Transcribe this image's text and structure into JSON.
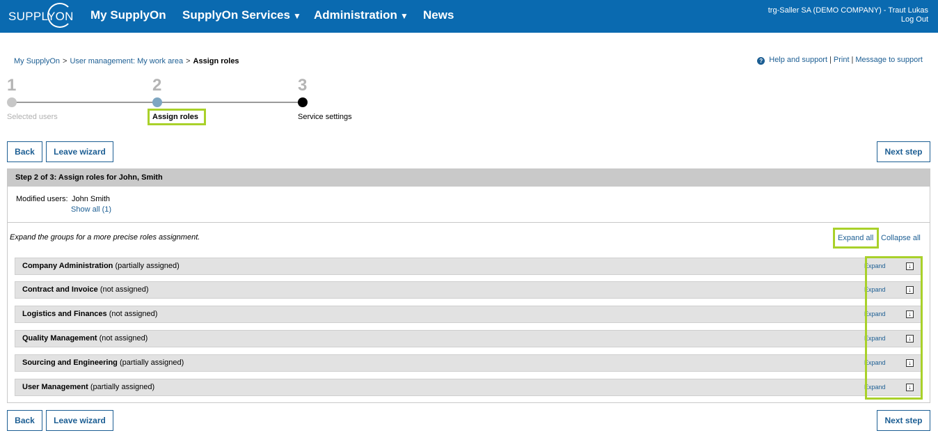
{
  "header": {
    "logo_text": "SUPPLYON",
    "nav": [
      {
        "label": "My SupplyOn"
      },
      {
        "label": "SupplyOn Services",
        "caret": "▼"
      },
      {
        "label": "Administration",
        "caret": "▼"
      },
      {
        "label": "News"
      }
    ],
    "user": "trg-Saller SA (DEMO COMPANY) - Traut Lukas",
    "logout": "Log Out"
  },
  "breadcrumb": {
    "items": [
      "My SupplyOn",
      "User management: My work area"
    ],
    "separator": ">",
    "current": "Assign roles"
  },
  "help": {
    "icon": "question-circle-icon",
    "links": [
      "Help and support",
      "Print",
      "Message to support"
    ]
  },
  "wizard": {
    "steps": [
      {
        "num": "1",
        "label": "Selected users",
        "state": "completed",
        "color": "#c7c7c7"
      },
      {
        "num": "2",
        "label": "Assign roles",
        "state": "current",
        "color": "#7ea6c1"
      },
      {
        "num": "3",
        "label": "Service settings",
        "state": "upcoming",
        "color": "#000000"
      }
    ]
  },
  "buttons": {
    "back": "Back",
    "leave": "Leave wizard",
    "next": "Next step"
  },
  "panel": {
    "title": "Step 2 of 3: Assign roles for John, Smith",
    "modified_label": "Modified users:",
    "modified_value": "John Smith",
    "show_all": "Show all (1)",
    "hint": "Expand the groups for a more precise roles assignment.",
    "expand_all": "Expand all",
    "collapse_all": "Collapse all",
    "groups": [
      {
        "name": "Company Administration",
        "status": "(partially assigned)",
        "expand": "Expand"
      },
      {
        "name": "Contract and Invoice",
        "status": "(not assigned)",
        "expand": "Expand"
      },
      {
        "name": "Logistics and Finances",
        "status": "(not assigned)",
        "expand": "Expand"
      },
      {
        "name": "Quality Management",
        "status": "(not assigned)",
        "expand": "Expand"
      },
      {
        "name": "Sourcing and Engineering",
        "status": "(partially assigned)",
        "expand": "Expand"
      },
      {
        "name": "User Management",
        "status": "(partially assigned)",
        "expand": "Expand"
      }
    ]
  },
  "colors": {
    "brand": "#0a6ab0",
    "link": "#1c5e93",
    "highlight": "#a9d12a"
  }
}
